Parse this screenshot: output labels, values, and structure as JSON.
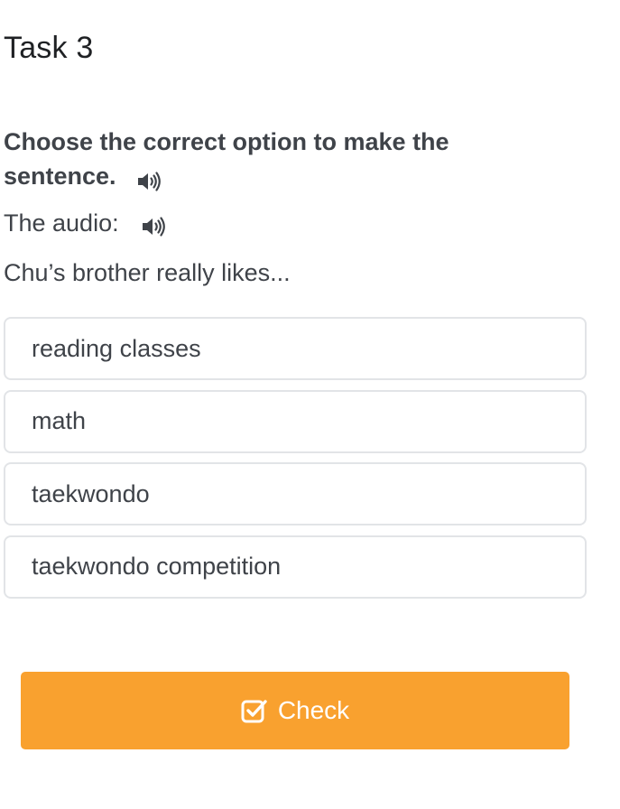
{
  "task": {
    "title": "Task 3"
  },
  "question": {
    "instruction": "Choose the correct option to make the sentence.",
    "instruction_audio_icon": "speaker-icon",
    "audio_label": "The audio:",
    "audio_icon": "speaker-icon",
    "prompt": "Chu’s brother really likes..."
  },
  "options": [
    {
      "label": "reading classes"
    },
    {
      "label": "math"
    },
    {
      "label": "taekwondo"
    },
    {
      "label": "taekwondo competition"
    }
  ],
  "actions": {
    "check_label": "Check",
    "check_icon": "checkbox-check-icon"
  },
  "colors": {
    "accent": "#f9a12f",
    "option_border": "#e2e4e7",
    "text": "#3f4349"
  }
}
